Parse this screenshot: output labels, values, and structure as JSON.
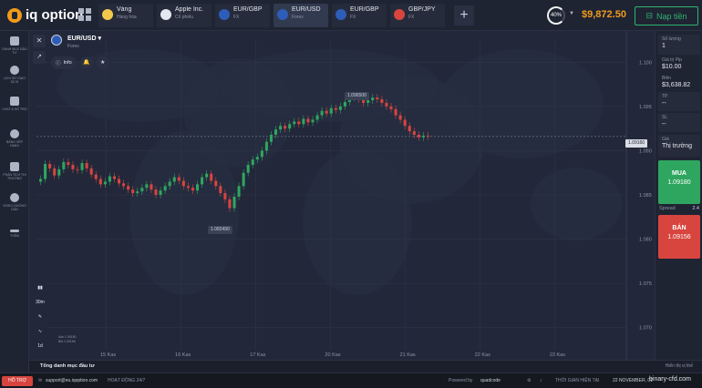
{
  "brand": {
    "name": "iq option"
  },
  "tabs": [
    {
      "title": "Vàng",
      "sub": "Hàng hóa",
      "color": "#f2c94c"
    },
    {
      "title": "Apple Inc.",
      "sub": "Cổ phiếu",
      "color": "#e3e7ef"
    },
    {
      "title": "EUR/GBP",
      "sub": "FX",
      "color": "#2d5db8"
    },
    {
      "title": "EUR/USD",
      "sub": "Forex",
      "color": "#2d5db8"
    },
    {
      "title": "EUR/GBP",
      "sub": "FX",
      "color": "#2d5db8"
    },
    {
      "title": "GBP/JPY",
      "sub": "FX",
      "color": "#d8453f"
    }
  ],
  "header": {
    "plus": "+",
    "percent": "40%",
    "balance": "$9,872.50",
    "deposit": "Nạp tiền"
  },
  "nav": [
    {
      "label": "DANH MỤC ĐẦU TƯ"
    },
    {
      "label": "LỊCH SỬ GIAO DỊCH"
    },
    {
      "label": "CHAT & HỖ TRỢ"
    },
    {
      "label": "BẢNG XẾP HẠNG"
    },
    {
      "label": "PHÂN TÍCH THỊ TRƯỜNG"
    },
    {
      "label": "VIDEO HƯỚNG DẪN"
    },
    {
      "label": "THÊM"
    }
  ],
  "asset": {
    "pair": "EUR/USD",
    "caret": "▾",
    "type": "Forex",
    "info": "Info"
  },
  "chart_data": {
    "type": "line",
    "x_labels": [
      "15 Kas",
      "16 Kas",
      "17 Kas",
      "20 Kas",
      "21 Kas",
      "22 Kas",
      "23 Kas"
    ],
    "y_ticks": [
      1.1,
      1.095,
      1.09,
      1.085,
      1.08,
      1.075,
      1.07
    ],
    "ylim": [
      1.0675,
      1.1025
    ],
    "current_price": "1.09160",
    "callouts": {
      "high": "1.096500",
      "low": "1.082490"
    },
    "series": [
      {
        "values": [
          1.0868,
          1.0885,
          1.088,
          1.0872,
          1.0879,
          1.0887,
          1.0884,
          1.0879,
          1.0878,
          1.0886,
          1.088,
          1.0873,
          1.0868,
          1.0862,
          1.0865,
          1.0871,
          1.0868,
          1.0863,
          1.086,
          1.0856,
          1.0852,
          1.0854,
          1.0858,
          1.0862,
          1.0856,
          1.085,
          1.0855,
          1.086,
          1.0865,
          1.087,
          1.0866,
          1.086,
          1.0858,
          1.0855,
          1.0862,
          1.087,
          1.0874,
          1.0866,
          1.086,
          1.0852,
          1.0845,
          1.0835,
          1.0848,
          1.086,
          1.0875,
          1.0884,
          1.089,
          1.0893,
          1.09,
          1.091,
          1.0918,
          1.0924,
          1.0928,
          1.0925,
          1.093,
          1.0933,
          1.093,
          1.0936,
          1.0932,
          1.0935,
          1.094,
          1.0945,
          1.0942,
          1.0948,
          1.0946,
          1.095,
          1.0955,
          1.096,
          1.0962,
          1.0958,
          1.0954,
          1.0957,
          1.096,
          1.0958,
          1.0954,
          1.095,
          1.0947,
          1.094,
          1.0935,
          1.0928,
          1.0922,
          1.0918,
          1.0915,
          1.0917,
          1.0916
        ]
      }
    ]
  },
  "side": {
    "amount_label": "Số lượng",
    "amount_value": "1",
    "pip_label": "Giá trị Pip",
    "pip_value": "$10.00",
    "margin_label": "Biên",
    "margin_value": "$3,638.82",
    "tp_label": "TP",
    "tp_value": "--",
    "sl_label": "SL",
    "sl_value": "--",
    "price_label": "Giá",
    "price_value": "Thị trường",
    "buy_label": "MUA",
    "buy_value": "1.09180",
    "spread_label": "Spread",
    "spread_value": "2.4",
    "sell_label": "BÁN",
    "sell_value": "1.09156"
  },
  "tools": {
    "close": "✕",
    "timeframe": "30m",
    "period": "1d"
  },
  "legend_note": {
    "line1": "Ask 1.09180",
    "line2": "Bid 1.09156"
  },
  "portfolio": {
    "label": "Tổng danh mục đầu tư",
    "right": "Hiển thị vị thế"
  },
  "footer": {
    "help": "HỖ TRỢ",
    "email": "support@eu.iqoption.com",
    "hours": "HOẠT ĐỘNG 24/7",
    "powered": "Powered by",
    "powered_brand": "quadcode",
    "time_label": "THỜI GIAN HIỆN TẠI",
    "time_value": "22 NOVEMBER, 01",
    "watermark": "binary-cfd.com"
  },
  "colors": {
    "up": "#2fa660",
    "down": "#d8453f",
    "accent": "#f29b1b"
  }
}
